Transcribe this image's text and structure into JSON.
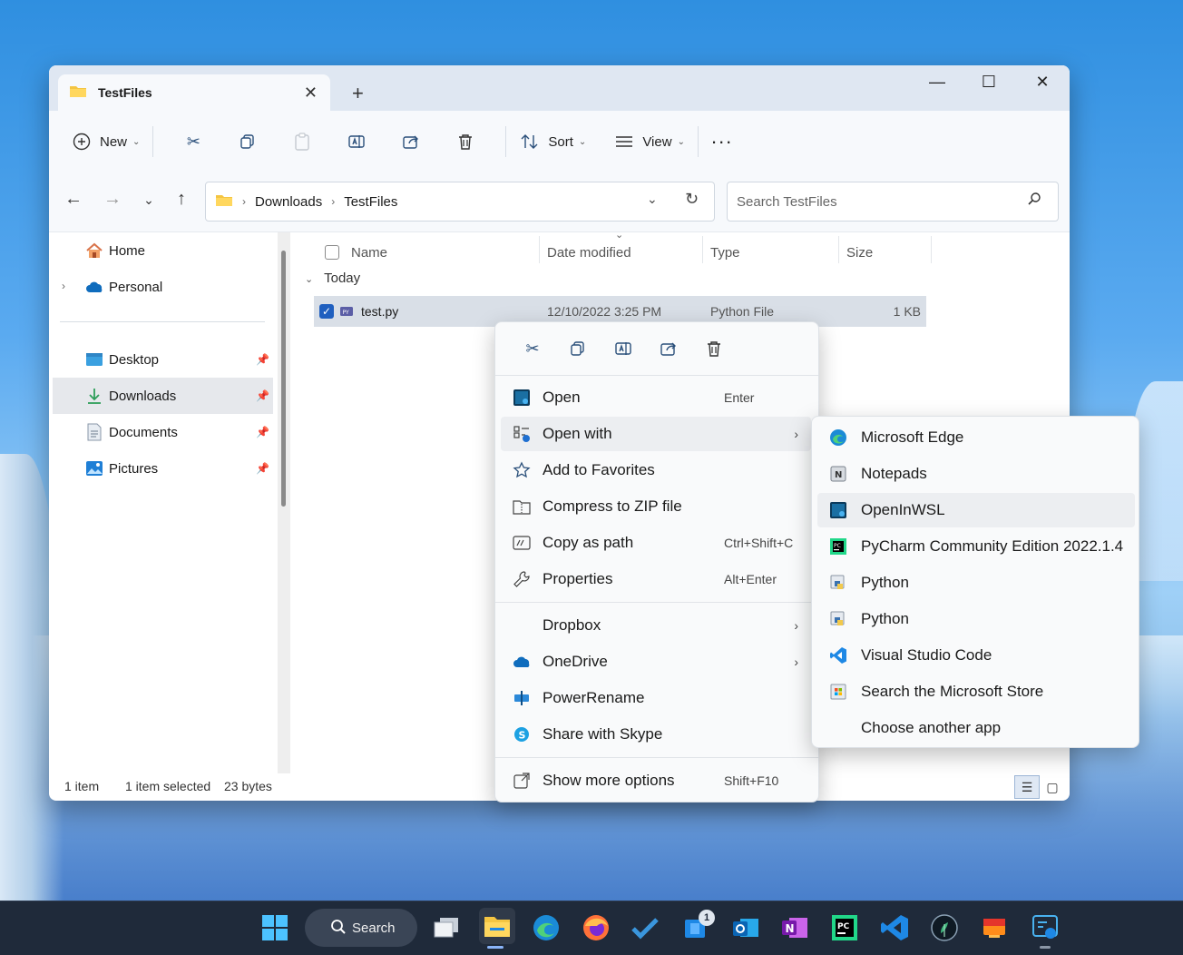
{
  "window": {
    "tab_title": "TestFiles",
    "icons": {
      "tab": "folder-icon",
      "close": "close-icon",
      "new_tab": "plus-icon"
    }
  },
  "toolbar": {
    "new_label": "New",
    "sort_label": "Sort",
    "view_label": "View",
    "more_label": "..."
  },
  "address": {
    "crumbs": [
      "Downloads",
      "TestFiles"
    ],
    "search_placeholder": "Search TestFiles"
  },
  "sidebar": {
    "items": [
      {
        "label": "Home"
      },
      {
        "label": "Personal"
      },
      {
        "label": "Desktop"
      },
      {
        "label": "Downloads"
      },
      {
        "label": "Documents"
      },
      {
        "label": "Pictures"
      }
    ]
  },
  "content": {
    "columns": [
      "Name",
      "Date modified",
      "Type",
      "Size"
    ],
    "group": "Today",
    "file": {
      "name": "test.py",
      "date": "12/10/2022 3:25 PM",
      "type": "Python File",
      "size": "1 KB"
    }
  },
  "status": {
    "items": "1 item",
    "selected": "1 item selected",
    "bytes": "23 bytes"
  },
  "context_menu": {
    "items": [
      {
        "label": "Open",
        "shortcut": "Enter"
      },
      {
        "label": "Open with"
      },
      {
        "label": "Add to Favorites"
      },
      {
        "label": "Compress to ZIP file"
      },
      {
        "label": "Copy as path",
        "shortcut": "Ctrl+Shift+C"
      },
      {
        "label": "Properties",
        "shortcut": "Alt+Enter"
      },
      {
        "label": "Dropbox"
      },
      {
        "label": "OneDrive"
      },
      {
        "label": "PowerRename"
      },
      {
        "label": "Share with Skype"
      },
      {
        "label": "Show more options",
        "shortcut": "Shift+F10"
      }
    ]
  },
  "open_with": {
    "items": [
      {
        "label": "Microsoft Edge"
      },
      {
        "label": "Notepads"
      },
      {
        "label": "OpenInWSL"
      },
      {
        "label": "PyCharm Community Edition 2022.1.4"
      },
      {
        "label": "Python"
      },
      {
        "label": "Python"
      },
      {
        "label": "Visual Studio Code"
      },
      {
        "label": "Search the Microsoft Store"
      },
      {
        "label": "Choose another app"
      }
    ]
  },
  "taskbar": {
    "search_label": "Search",
    "badge": "1"
  },
  "colors": {
    "accent": "#1f5fbf",
    "selection": "#d9dfe7",
    "taskbar": "#1f2a3a"
  }
}
